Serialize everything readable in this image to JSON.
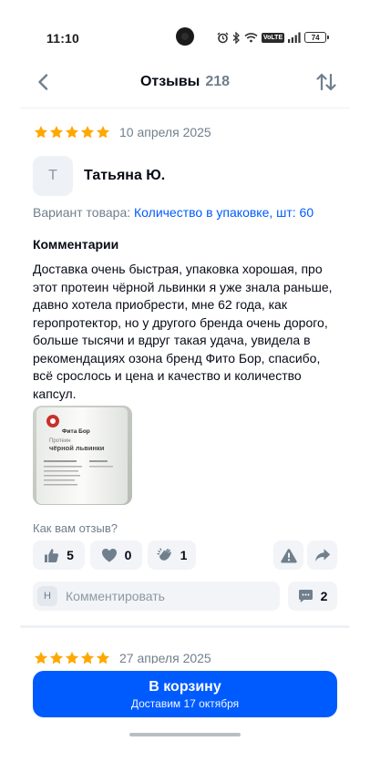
{
  "status": {
    "time": "11:10",
    "volte_label": "VoLTE",
    "battery": "74"
  },
  "header": {
    "title": "Отзывы",
    "count": "218"
  },
  "review": {
    "rating": 5,
    "date": "10 апреля 2025",
    "avatar_letter": "Т",
    "author": "Татьяна Ю.",
    "variant_label": "Вариант товара:",
    "variant_value": "Количество в упаковке, шт: 60",
    "comments_heading": "Комментарии",
    "text": "Доставка очень быстрая, упаковка хорошая, про этот протеин чёрной львинки я уже знала раньше, давно хотела приобрести, мне 62 года, как геропротектор, но у другого бренда очень дорого, больше тысячи и вдруг такая удача, увидела в рекомендациях озона бренд Фито Бор, спасибо, всё срослось и цена и качество и количество капсул.",
    "photo_texts": {
      "brand": "Фита Бор",
      "line1": "Протеин",
      "line2": "чёрной львинки"
    },
    "question": "Как вам отзыв?",
    "likes": "5",
    "hearts": "0",
    "claps": "1",
    "comment_avatar_letter": "Н",
    "comment_placeholder": "Комментировать",
    "comments_count": "2"
  },
  "next_review": {
    "rating": 5,
    "date": "27 апреля 2025"
  },
  "cart": {
    "label": "В корзину",
    "delivery": "Доставим 17 октября"
  },
  "colors": {
    "accent": "#005bff",
    "star": "#ffa800",
    "muted": "#707f8d",
    "chip_bg": "#f2f4f7"
  }
}
